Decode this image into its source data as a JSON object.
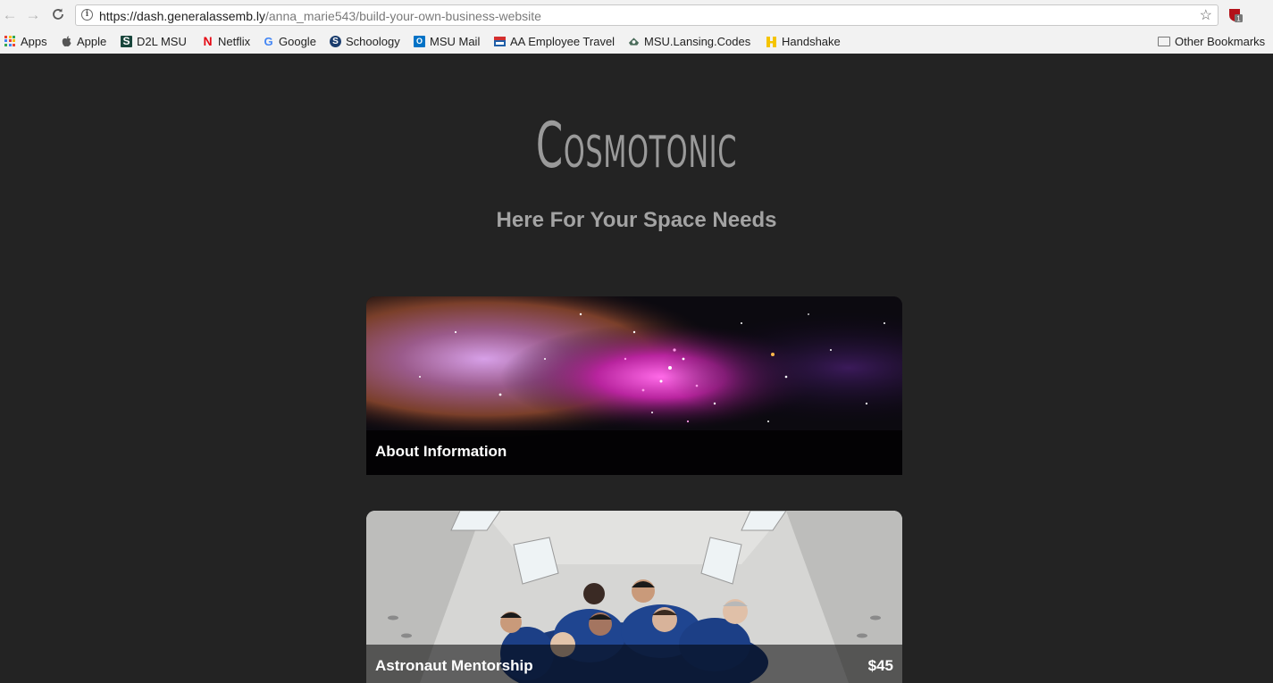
{
  "browser": {
    "url_host": "https://dash.generalassemb.ly",
    "url_path": "/anna_marie543/build-your-own-business-website",
    "extension_badge": "1"
  },
  "bookmarks": {
    "items": [
      {
        "label": "Apps",
        "icon": "apps-grid-icon"
      },
      {
        "label": "Apple",
        "icon": "apple-icon"
      },
      {
        "label": "D2L MSU",
        "icon": "msu-s-icon"
      },
      {
        "label": "Netflix",
        "icon": "netflix-icon"
      },
      {
        "label": "Google",
        "icon": "google-icon"
      },
      {
        "label": "Schoology",
        "icon": "schoology-icon"
      },
      {
        "label": "MSU Mail",
        "icon": "outlook-icon"
      },
      {
        "label": "AA Employee Travel",
        "icon": "aa-icon"
      },
      {
        "label": "MSU.Lansing.Codes",
        "icon": "msu-codes-icon"
      },
      {
        "label": "Handshake",
        "icon": "handshake-icon"
      }
    ],
    "other": "Other Bookmarks"
  },
  "site": {
    "logo": "Cosmotonic",
    "tagline": "Here For Your Space Needs",
    "cards": [
      {
        "title": "About Information",
        "image": "nebula-image"
      },
      {
        "title": "Astronaut Mentorship",
        "price": "$45",
        "image": "astronauts-image"
      }
    ]
  },
  "colors": {
    "page_bg": "#232323",
    "logo": "#9a9a9a",
    "tagline": "#a3a3a3"
  }
}
